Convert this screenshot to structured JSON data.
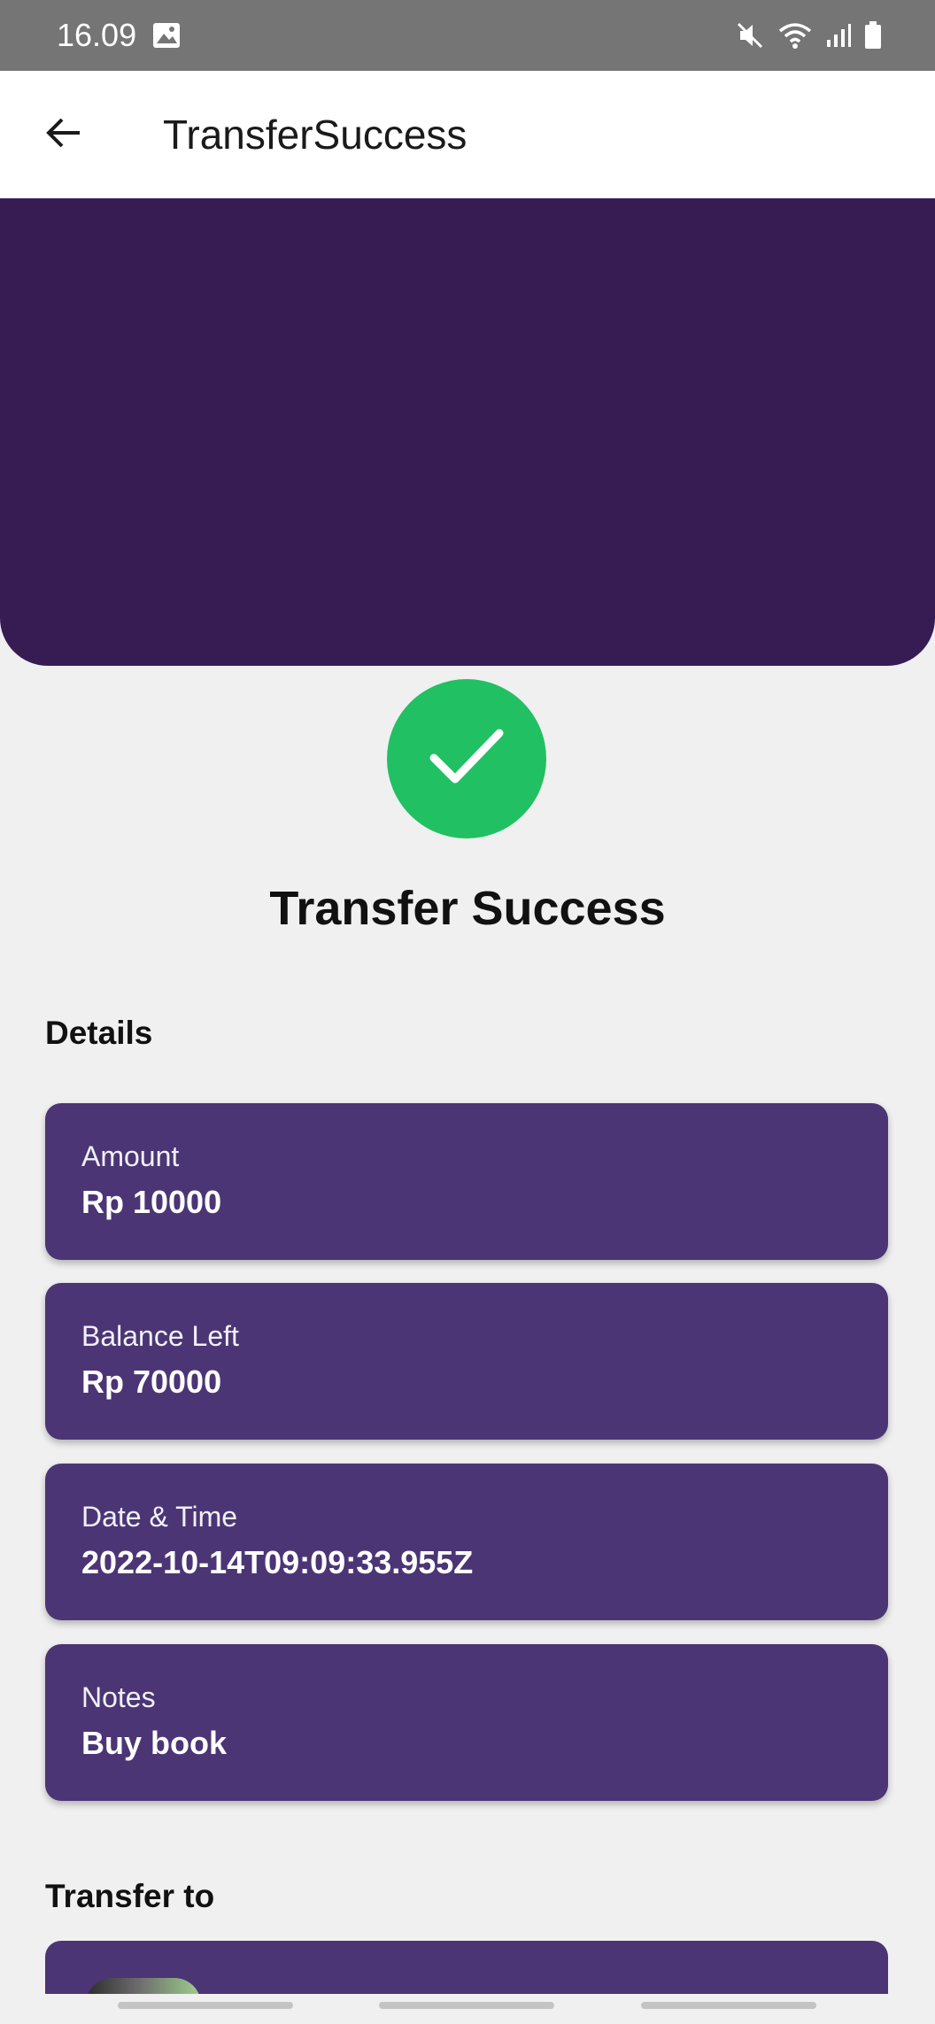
{
  "status_bar": {
    "time": "16.09",
    "icons": [
      "gallery-icon",
      "mute-icon",
      "wifi-icon",
      "signal-icon",
      "battery-icon"
    ]
  },
  "app_bar": {
    "title": "TransferSuccess",
    "back_icon": "arrow-left-icon"
  },
  "colors": {
    "hero": "#371c54",
    "card": "#4b3575",
    "success": "#21c063",
    "background": "#f0f0f0"
  },
  "success": {
    "icon": "check-icon",
    "heading": "Transfer Success"
  },
  "details": {
    "label": "Details",
    "items": [
      {
        "label": "Amount",
        "value": "Rp 10000"
      },
      {
        "label": "Balance Left",
        "value": "Rp 70000"
      },
      {
        "label": "Date & Time",
        "value": "2022-10-14T09:09:33.955Z"
      },
      {
        "label": "Notes",
        "value": "Buy book"
      }
    ]
  },
  "transfer_to": {
    "label": "Transfer to"
  }
}
